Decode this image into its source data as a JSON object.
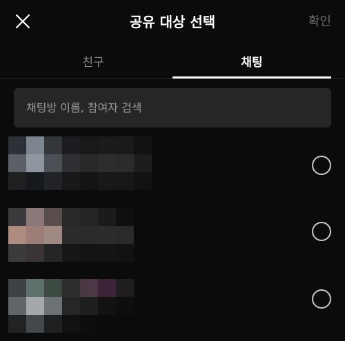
{
  "header": {
    "title": "공유 대상 선택",
    "confirm_label": "확인"
  },
  "tabs": [
    {
      "label": "친구",
      "active": false
    },
    {
      "label": "채팅",
      "active": true
    }
  ],
  "search": {
    "placeholder": "채팅방 이름, 참여자 검색",
    "value": ""
  },
  "colors": {
    "background": "#0b0b0b",
    "search_bg": "#262626",
    "inactive_text": "#8a8a8a",
    "confirm_disabled": "#6e6e6e",
    "radio_border": "#c9c9c9"
  },
  "chat_rooms": [
    {
      "selected": false
    },
    {
      "selected": false
    },
    {
      "selected": false
    }
  ]
}
